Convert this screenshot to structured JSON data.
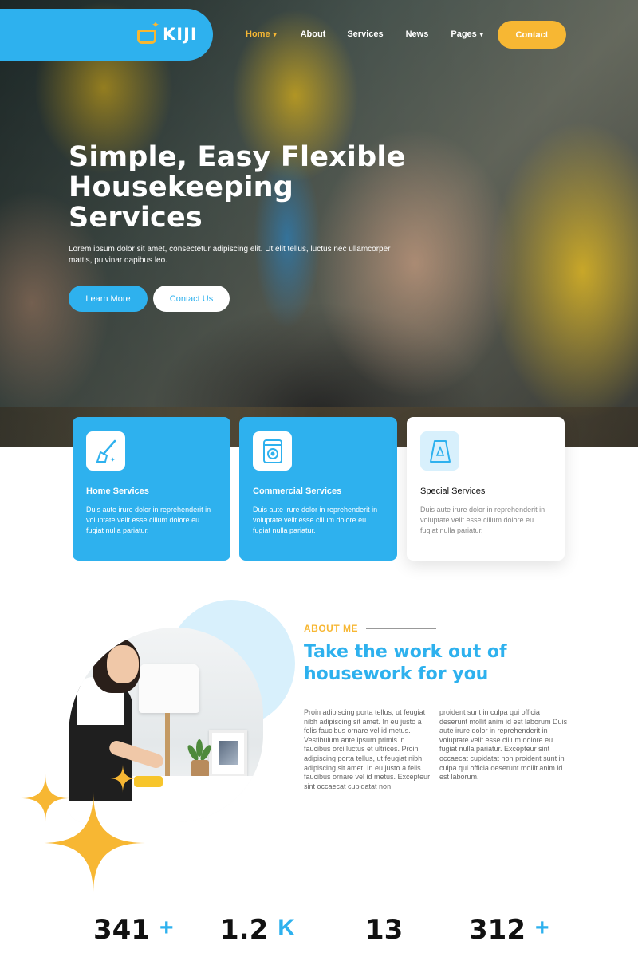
{
  "brand": {
    "name": "KIJI",
    "accent": "#2eb1ee",
    "secondary": "#f7b733"
  },
  "nav": {
    "items": [
      {
        "label": "Home",
        "active": true,
        "has_dropdown": true
      },
      {
        "label": "About",
        "active": false,
        "has_dropdown": false
      },
      {
        "label": "Services",
        "active": false,
        "has_dropdown": false
      },
      {
        "label": "News",
        "active": false,
        "has_dropdown": false
      },
      {
        "label": "Pages",
        "active": false,
        "has_dropdown": true
      }
    ],
    "contact_label": "Contact"
  },
  "hero": {
    "title_line1": "Simple, Easy Flexible",
    "title_line2": "Housekeeping",
    "title_line3": "Services",
    "text": "Lorem ipsum dolor sit amet, consectetur adipiscing elit. Ut elit tellus, luctus nec ullamcorper mattis, pulvinar dapibus leo.",
    "learn_more_label": "Learn More",
    "contact_us_label": "Contact Us"
  },
  "services": [
    {
      "title": "Home Services",
      "text": "Duis aute irure dolor in reprehenderit in voluptate velit esse cillum dolore eu fugiat nulla pariatur.",
      "icon": "mop-icon"
    },
    {
      "title": "Commercial Services",
      "text": "Duis aute irure dolor in reprehenderit in voluptate velit esse cillum dolore eu fugiat nulla pariatur.",
      "icon": "washing-machine-icon"
    },
    {
      "title": "Special Services",
      "text": "Duis aute irure dolor in reprehenderit in voluptate velit esse cillum dolore eu fugiat nulla pariatur.",
      "icon": "wet-floor-sign-icon"
    }
  ],
  "about": {
    "label": "ABOUT ME",
    "heading": "Take the work out of housework for you",
    "col1": "Proin adipiscing porta tellus, ut feugiat nibh adipiscing sit amet. In eu justo a felis faucibus ornare vel id metus. Vestibulum ante ipsum primis in faucibus orci luctus et ultrices. Proin adipiscing porta tellus, ut feugiat nibh adipiscing sit amet. In eu justo a felis faucibus ornare vel id metus. Excepteur sint occaecat cupidatat non",
    "col2": "proident sunt in culpa qui officia deserunt mollit anim id est laborum Duis aute irure dolor in reprehenderit in voluptate velit esse cillum dolore eu fugiat nulla pariatur. Excepteur sint occaecat cupidatat non proident sunt in culpa qui officia deserunt mollit anim id est laborum."
  },
  "stats": [
    {
      "value": "341",
      "suffix": "+"
    },
    {
      "value": "1.2",
      "suffix": "K"
    },
    {
      "value": "13",
      "suffix": ""
    },
    {
      "value": "312",
      "suffix": "+"
    }
  ]
}
